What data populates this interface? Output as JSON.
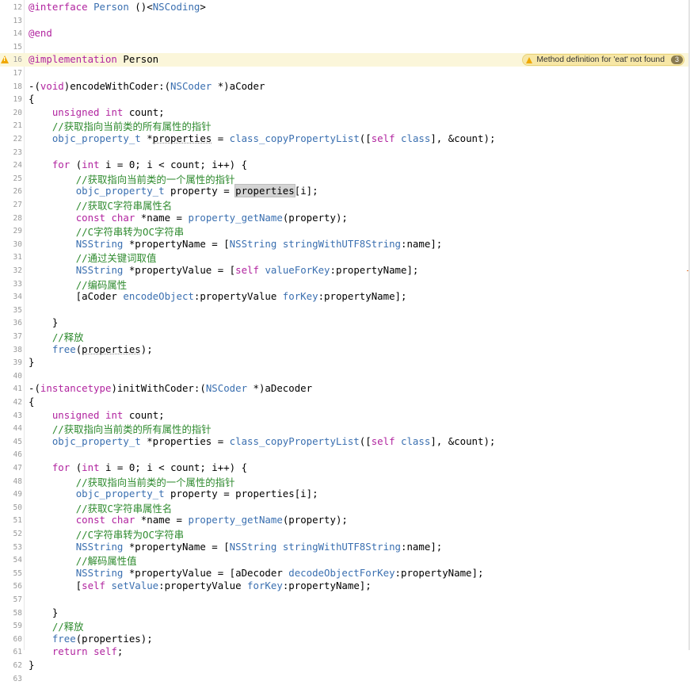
{
  "editor": {
    "issue_message": "Method definition for 'eat' not found",
    "issue_count": "3",
    "colors": {
      "keyword": "#b1249f",
      "type": "#3a6fb0",
      "comment": "#2e8a2e",
      "line_number": "#9a9a9a",
      "highlighted_line": "#fbf6da",
      "warning": "#f0a800"
    },
    "warning_line": "16",
    "lines": [
      {
        "n": "12",
        "t": [
          {
            "k": "kw",
            "s": "@interface"
          },
          {
            "s": " "
          },
          {
            "k": "ty",
            "s": "Person"
          },
          {
            "s": " ()<"
          },
          {
            "k": "ty",
            "s": "NSCoding"
          },
          {
            "s": ">"
          }
        ]
      },
      {
        "n": "13",
        "t": []
      },
      {
        "n": "14",
        "t": [
          {
            "k": "kw",
            "s": "@end"
          }
        ]
      },
      {
        "n": "15",
        "t": []
      },
      {
        "n": "16",
        "t": [
          {
            "k": "kw",
            "s": "@implementation"
          },
          {
            "s": " Person"
          }
        ]
      },
      {
        "n": "17",
        "t": []
      },
      {
        "n": "18",
        "t": [
          {
            "s": "-("
          },
          {
            "k": "kw",
            "s": "void"
          },
          {
            "s": ")encodeWithCoder:("
          },
          {
            "k": "ty",
            "s": "NSCoder"
          },
          {
            "s": " *)aCoder"
          }
        ]
      },
      {
        "n": "19",
        "t": [
          {
            "s": "{"
          }
        ]
      },
      {
        "n": "20",
        "t": [
          {
            "s": "    "
          },
          {
            "k": "kw",
            "s": "unsigned"
          },
          {
            "s": " "
          },
          {
            "k": "kw",
            "s": "int"
          },
          {
            "s": " count;"
          }
        ]
      },
      {
        "n": "21",
        "t": [
          {
            "s": "    "
          },
          {
            "k": "cm",
            "s": "//获取指向当前类的所有属性的指针"
          }
        ]
      },
      {
        "n": "22",
        "t": [
          {
            "s": "    "
          },
          {
            "k": "ty",
            "s": "objc_property_t"
          },
          {
            "s": " *"
          },
          {
            "k": "sq",
            "s": "properties"
          },
          {
            "s": " = "
          },
          {
            "k": "fn",
            "s": "class_copyPropertyList"
          },
          {
            "s": "(["
          },
          {
            "k": "kw",
            "s": "self"
          },
          {
            "s": " "
          },
          {
            "k": "fn",
            "s": "class"
          },
          {
            "s": "], &count);"
          }
        ]
      },
      {
        "n": "23",
        "t": []
      },
      {
        "n": "24",
        "t": [
          {
            "s": "    "
          },
          {
            "k": "kw",
            "s": "for"
          },
          {
            "s": " ("
          },
          {
            "k": "kw",
            "s": "int"
          },
          {
            "s": " i = 0; i < count; i++) {"
          }
        ]
      },
      {
        "n": "25",
        "t": [
          {
            "s": "        "
          },
          {
            "k": "cm",
            "s": "//获取指向当前类的一个属性的指针"
          }
        ]
      },
      {
        "n": "26",
        "t": [
          {
            "s": "        "
          },
          {
            "k": "ty",
            "s": "objc_property_t"
          },
          {
            "s": " property = "
          },
          {
            "k": "hl",
            "s": "properties"
          },
          {
            "s": "[i];"
          }
        ]
      },
      {
        "n": "27",
        "t": [
          {
            "s": "        "
          },
          {
            "k": "cm",
            "s": "//获取C字符串属性名"
          }
        ]
      },
      {
        "n": "28",
        "t": [
          {
            "s": "        "
          },
          {
            "k": "kw",
            "s": "const"
          },
          {
            "s": " "
          },
          {
            "k": "kw",
            "s": "char"
          },
          {
            "s": " *name = "
          },
          {
            "k": "fn",
            "s": "property_getName"
          },
          {
            "s": "(property);"
          }
        ]
      },
      {
        "n": "29",
        "t": [
          {
            "s": "        "
          },
          {
            "k": "cm",
            "s": "//C字符串转为OC字符串"
          }
        ]
      },
      {
        "n": "30",
        "t": [
          {
            "s": "        "
          },
          {
            "k": "ty",
            "s": "NSString"
          },
          {
            "s": " *propertyName = ["
          },
          {
            "k": "ty",
            "s": "NSString"
          },
          {
            "s": " "
          },
          {
            "k": "fn",
            "s": "stringWithUTF8String"
          },
          {
            "s": ":name];"
          }
        ]
      },
      {
        "n": "31",
        "t": [
          {
            "s": "        "
          },
          {
            "k": "cm",
            "s": "//通过关键词取值"
          }
        ]
      },
      {
        "n": "32",
        "t": [
          {
            "s": "        "
          },
          {
            "k": "ty",
            "s": "NSString"
          },
          {
            "s": " *propertyValue = ["
          },
          {
            "k": "kw",
            "s": "self"
          },
          {
            "s": " "
          },
          {
            "k": "fn",
            "s": "valueForKey"
          },
          {
            "s": ":propertyName];"
          }
        ]
      },
      {
        "n": "33",
        "t": [
          {
            "s": "        "
          },
          {
            "k": "cm",
            "s": "//编码属性"
          }
        ]
      },
      {
        "n": "34",
        "t": [
          {
            "s": "        [aCoder "
          },
          {
            "k": "fn",
            "s": "encodeObject"
          },
          {
            "s": ":propertyValue "
          },
          {
            "k": "fn",
            "s": "forKey"
          },
          {
            "s": ":propertyName];"
          }
        ]
      },
      {
        "n": "35",
        "t": []
      },
      {
        "n": "36",
        "t": [
          {
            "s": "    }"
          }
        ]
      },
      {
        "n": "37",
        "t": [
          {
            "s": "    "
          },
          {
            "k": "cm",
            "s": "//释放"
          }
        ]
      },
      {
        "n": "38",
        "t": [
          {
            "s": "    "
          },
          {
            "k": "fn",
            "s": "free"
          },
          {
            "s": "("
          },
          {
            "k": "sq",
            "s": "properties"
          },
          {
            "s": ");"
          }
        ]
      },
      {
        "n": "39",
        "t": [
          {
            "s": "}"
          }
        ]
      },
      {
        "n": "40",
        "t": []
      },
      {
        "n": "41",
        "t": [
          {
            "s": "-("
          },
          {
            "k": "kw",
            "s": "instancetype"
          },
          {
            "s": ")initWithCoder:("
          },
          {
            "k": "ty",
            "s": "NSCoder"
          },
          {
            "s": " *)aDecoder"
          }
        ]
      },
      {
        "n": "42",
        "t": [
          {
            "s": "{"
          }
        ]
      },
      {
        "n": "43",
        "t": [
          {
            "s": "    "
          },
          {
            "k": "kw",
            "s": "unsigned"
          },
          {
            "s": " "
          },
          {
            "k": "kw",
            "s": "int"
          },
          {
            "s": " count;"
          }
        ]
      },
      {
        "n": "44",
        "t": [
          {
            "s": "    "
          },
          {
            "k": "cm",
            "s": "//获取指向当前类的所有属性的指针"
          }
        ]
      },
      {
        "n": "45",
        "t": [
          {
            "s": "    "
          },
          {
            "k": "ty",
            "s": "objc_property_t"
          },
          {
            "s": " *properties = "
          },
          {
            "k": "fn",
            "s": "class_copyPropertyList"
          },
          {
            "s": "(["
          },
          {
            "k": "kw",
            "s": "self"
          },
          {
            "s": " "
          },
          {
            "k": "fn",
            "s": "class"
          },
          {
            "s": "], &count);"
          }
        ]
      },
      {
        "n": "46",
        "t": []
      },
      {
        "n": "47",
        "t": [
          {
            "s": "    "
          },
          {
            "k": "kw",
            "s": "for"
          },
          {
            "s": " ("
          },
          {
            "k": "kw",
            "s": "int"
          },
          {
            "s": " i = 0; i < count; i++) {"
          }
        ]
      },
      {
        "n": "48",
        "t": [
          {
            "s": "        "
          },
          {
            "k": "cm",
            "s": "//获取指向当前类的一个属性的指针"
          }
        ]
      },
      {
        "n": "49",
        "t": [
          {
            "s": "        "
          },
          {
            "k": "ty",
            "s": "objc_property_t"
          },
          {
            "s": " property = properties[i];"
          }
        ]
      },
      {
        "n": "50",
        "t": [
          {
            "s": "        "
          },
          {
            "k": "cm",
            "s": "//获取C字符串属性名"
          }
        ]
      },
      {
        "n": "51",
        "t": [
          {
            "s": "        "
          },
          {
            "k": "kw",
            "s": "const"
          },
          {
            "s": " "
          },
          {
            "k": "kw",
            "s": "char"
          },
          {
            "s": " *name = "
          },
          {
            "k": "fn",
            "s": "property_getName"
          },
          {
            "s": "(property);"
          }
        ]
      },
      {
        "n": "52",
        "t": [
          {
            "s": "        "
          },
          {
            "k": "cm",
            "s": "//C字符串转为OC字符串"
          }
        ]
      },
      {
        "n": "53",
        "t": [
          {
            "s": "        "
          },
          {
            "k": "ty",
            "s": "NSString"
          },
          {
            "s": " *propertyName = ["
          },
          {
            "k": "ty",
            "s": "NSString"
          },
          {
            "s": " "
          },
          {
            "k": "fn",
            "s": "stringWithUTF8String"
          },
          {
            "s": ":name];"
          }
        ]
      },
      {
        "n": "54",
        "t": [
          {
            "s": "        "
          },
          {
            "k": "cm",
            "s": "//解码属性值"
          }
        ]
      },
      {
        "n": "55",
        "t": [
          {
            "s": "        "
          },
          {
            "k": "ty",
            "s": "NSString"
          },
          {
            "s": " *propertyValue = [aDecoder "
          },
          {
            "k": "fn",
            "s": "decodeObjectForKey"
          },
          {
            "s": ":propertyName];"
          }
        ]
      },
      {
        "n": "56",
        "t": [
          {
            "s": "        ["
          },
          {
            "k": "kw",
            "s": "self"
          },
          {
            "s": " "
          },
          {
            "k": "fn",
            "s": "setValue"
          },
          {
            "s": ":propertyValue "
          },
          {
            "k": "fn",
            "s": "forKey"
          },
          {
            "s": ":propertyName];"
          }
        ]
      },
      {
        "n": "57",
        "t": []
      },
      {
        "n": "58",
        "t": [
          {
            "s": "    }"
          }
        ]
      },
      {
        "n": "59",
        "t": [
          {
            "s": "    "
          },
          {
            "k": "cm",
            "s": "//释放"
          }
        ]
      },
      {
        "n": "60",
        "t": [
          {
            "s": "    "
          },
          {
            "k": "fn",
            "s": "free"
          },
          {
            "s": "(properties);"
          }
        ]
      },
      {
        "n": "61",
        "t": [
          {
            "s": "    "
          },
          {
            "k": "kw",
            "s": "return"
          },
          {
            "s": " "
          },
          {
            "k": "kw",
            "s": "self"
          },
          {
            "s": ";"
          }
        ]
      },
      {
        "n": "62",
        "t": [
          {
            "s": "}"
          }
        ]
      },
      {
        "n": "63",
        "t": []
      }
    ]
  }
}
